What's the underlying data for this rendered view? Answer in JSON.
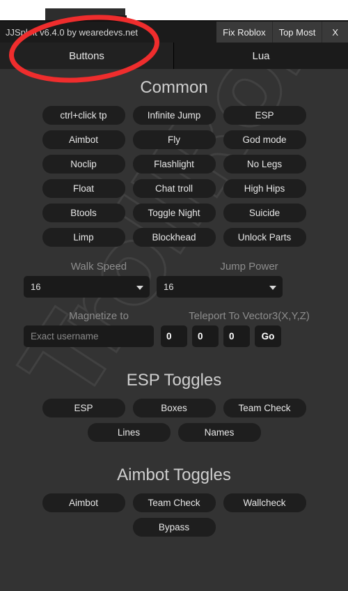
{
  "window": {
    "title": "JJSploit v6.4.0 by wearedevs.net",
    "titlebar_buttons": [
      {
        "label": "Fix Roblox",
        "name": "fix-roblox-button"
      },
      {
        "label": "Top Most",
        "name": "top-most-button"
      },
      {
        "label": "X",
        "name": "close-button"
      }
    ],
    "tabs": [
      {
        "label": "Buttons",
        "active": true
      },
      {
        "label": "Lua",
        "active": false
      }
    ],
    "watermark_text": "TrollRoblox"
  },
  "sections": [
    {
      "title": "Common",
      "rows": [
        [
          "ctrl+click tp",
          "Infinite Jump",
          "ESP"
        ],
        [
          "Aimbot",
          "Fly",
          "God mode"
        ],
        [
          "Noclip",
          "Flashlight",
          "No Legs"
        ],
        [
          "Float",
          "Chat troll",
          "High Hips"
        ],
        [
          "Btools",
          "Toggle Night",
          "Suicide"
        ],
        [
          "Limp",
          "Blockhead",
          "Unlock Parts"
        ]
      ]
    },
    {
      "title": "ESP Toggles",
      "rows": [
        [
          "ESP",
          "Boxes",
          "Team Check"
        ],
        [
          "Lines",
          "Names"
        ]
      ]
    },
    {
      "title": "Aimbot Toggles",
      "rows": [
        [
          "Aimbot",
          "Team Check",
          "Wallcheck"
        ],
        [
          "Bypass"
        ]
      ]
    }
  ],
  "fields": {
    "walk_speed": {
      "label": "Walk Speed",
      "value": "16"
    },
    "jump_power": {
      "label": "Jump Power",
      "value": "16"
    },
    "magnetize": {
      "label": "Magnetize to",
      "value": "",
      "placeholder": "Exact username"
    },
    "teleport": {
      "label": "Teleport To Vector3(X,Y,Z)",
      "x": "0",
      "y": "0",
      "z": "0",
      "go_label": "Go"
    }
  },
  "colors": {
    "panel_bg": "#333333",
    "button_bg": "#1e1e1e",
    "titlebar_bg": "#1b1b1b",
    "annotation": "#ef2d2d"
  }
}
